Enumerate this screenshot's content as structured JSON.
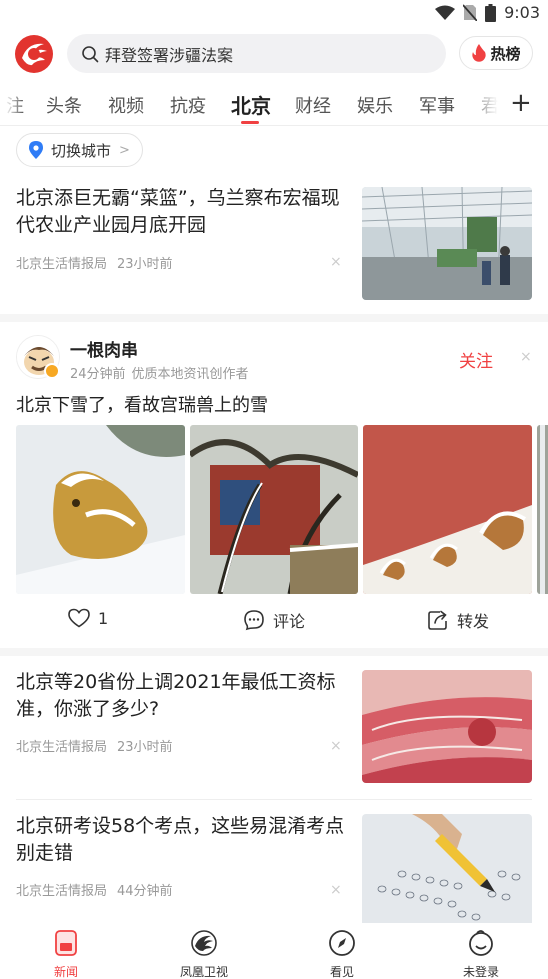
{
  "status": {
    "time": "9:03"
  },
  "search": {
    "text": "拜登签署涉疆法案"
  },
  "hot": {
    "label": "热榜"
  },
  "tabs": {
    "partial_left": "注",
    "items": [
      "头条",
      "视频",
      "抗疫",
      "北京",
      "财经",
      "娱乐",
      "军事",
      "君"
    ],
    "active": "北京",
    "add_icon": "+"
  },
  "city": {
    "label": "切换城市"
  },
  "news": [
    {
      "title": "北京添巨无霸“菜篮”，乌兰察布宏福现代农业产业园月底开园",
      "source": "北京生活情报局",
      "time": "23小时前"
    },
    {
      "title": "北京等20省份上调2021年最低工资标准，你涨了多少?",
      "source": "北京生活情报局",
      "time": "23小时前"
    },
    {
      "title": "北京研考设58个考点，这些易混淆考点别走错",
      "source": "北京生活情报局",
      "time": "44分钟前"
    }
  ],
  "post": {
    "author": "一根肉串",
    "time": "24分钟前",
    "desc": "优质本地资讯创作者",
    "follow": "关注",
    "text": "北京下雪了，看故宫瑞兽上的雪",
    "likes": "1",
    "comment_label": "评论",
    "share_label": "转发"
  },
  "dismiss_glyph": "×",
  "bottom_nav": [
    {
      "label": "新闻",
      "icon": "news-icon"
    },
    {
      "label": "凤凰卫视",
      "icon": "phoenix-tv-icon"
    },
    {
      "label": "看见",
      "icon": "compass-icon"
    },
    {
      "label": "未登录",
      "icon": "user-icon"
    }
  ],
  "colors": {
    "accent": "#f04142",
    "verified": "#f7a823"
  }
}
